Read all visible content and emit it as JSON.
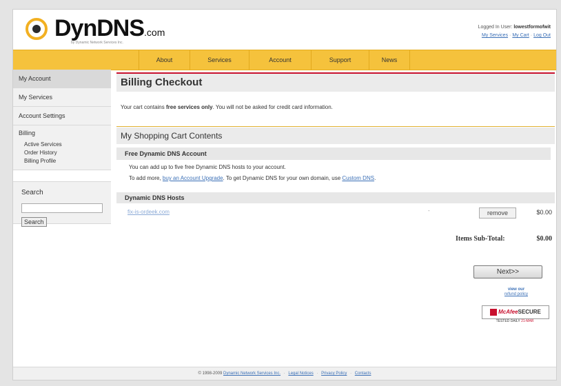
{
  "header": {
    "logo_text": "DynDNS",
    "logo_suffix": ".com",
    "logo_sub": "by Dynamic Network Services Inc.",
    "logged_in_label": "Logged In User:",
    "username": "lowestformofwit",
    "links": [
      "My Services",
      "My Cart",
      "Log Out"
    ]
  },
  "nav": {
    "items": [
      "About",
      "Services",
      "Account",
      "Support",
      "News"
    ]
  },
  "sidebar": {
    "items": [
      "My Account",
      "My Services",
      "Account Settings"
    ],
    "billing_title": "Billing",
    "billing_subitems": [
      "Active Services",
      "Order History",
      "Billing Profile"
    ],
    "search_label": "Search",
    "search_value": "",
    "search_button": "Search"
  },
  "main": {
    "title": "Billing Checkout",
    "notice_pre": "Your cart contains ",
    "notice_bold": "free services only",
    "notice_post": ". You will not be asked for credit card information.",
    "cart_heading": "My Shopping Cart Contents",
    "free_heading": "Free Dynamic DNS Account",
    "free_line1": "You can add up to five free Dynamic DNS hosts to your account.",
    "free_line2_pre": "To add more, ",
    "free_line2_link1": "buy an Account Upgrade",
    "free_line2_mid": ". To get Dynamic DNS for your own domain, use ",
    "free_line2_link2": "Custom DNS",
    "free_line2_post": ".",
    "hosts_heading": "Dynamic DNS Hosts",
    "host_name": "fix-is-ordeek.com",
    "host_dash": "-",
    "remove_label": "remove",
    "host_price": "$0.00",
    "subtotal_label": "Items Sub-Total:",
    "subtotal_value": "$0.00",
    "next_label": "Next>>",
    "refund_line1": "view our",
    "refund_line2": "refund policy",
    "mcafee_brand": "McAfee",
    "mcafee_secure": "SECURE",
    "tested_label": "TESTED DAILY",
    "tested_date": "21-MAR"
  },
  "footer": {
    "copyright": "© 1998-2009",
    "links": [
      "Dynamic Network Services Inc.",
      "Legal Notices",
      "Privacy Policy",
      "Contacts"
    ]
  }
}
